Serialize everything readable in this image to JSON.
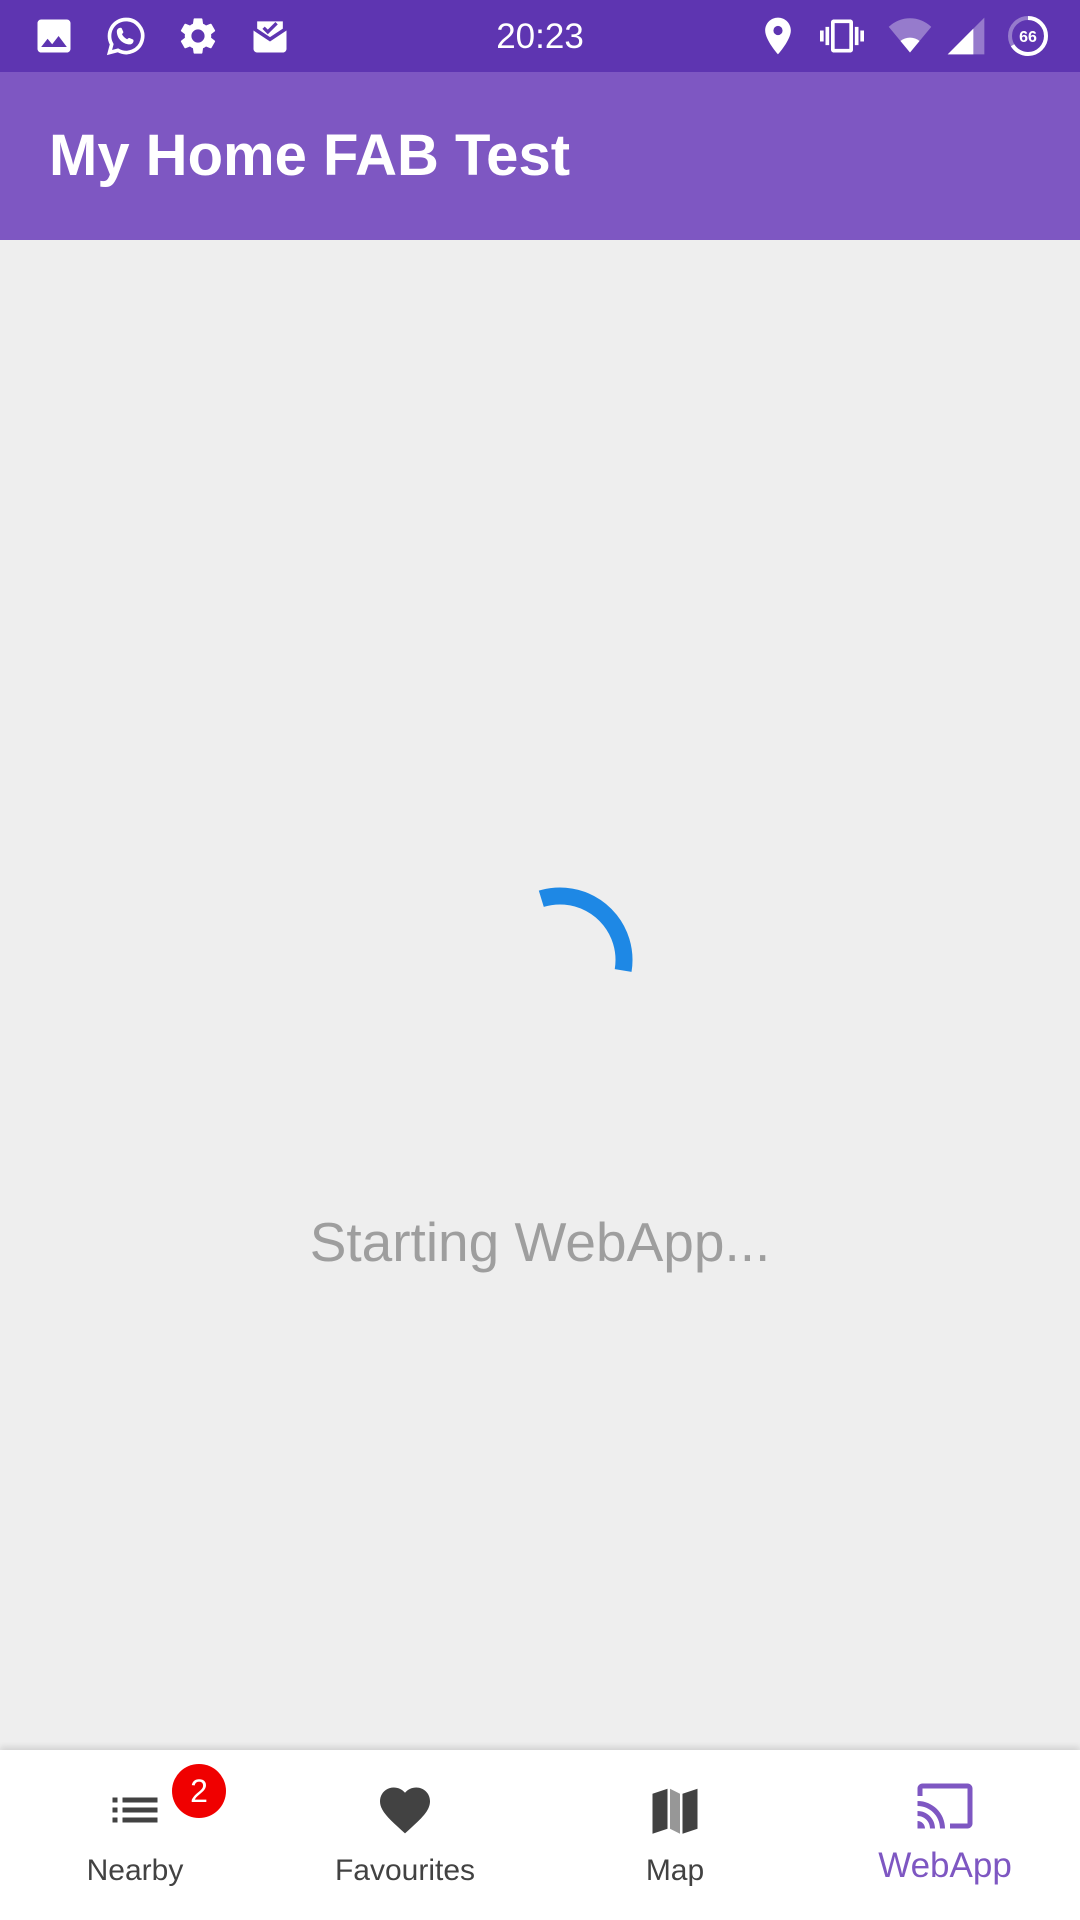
{
  "status_bar": {
    "time": "20:23",
    "battery_level": "66",
    "left_icons": [
      "gallery-icon",
      "whatsapp-icon",
      "settings-icon",
      "mail-check-icon"
    ],
    "right_icons": [
      "location-icon",
      "vibrate-icon",
      "wifi-icon",
      "cellular-signal-icon",
      "battery-saver-icon"
    ]
  },
  "app_bar": {
    "title": "My Home FAB Test"
  },
  "content": {
    "loading_text": "Starting WebApp...",
    "spinner_color": "#1e88e5"
  },
  "bottom_nav": {
    "items": [
      {
        "label": "Nearby",
        "icon": "list-icon",
        "badge": "2",
        "active": false
      },
      {
        "label": "Favourites",
        "icon": "heart-icon",
        "active": false
      },
      {
        "label": "Map",
        "icon": "map-icon",
        "active": false
      },
      {
        "label": "WebApp",
        "icon": "cast-icon",
        "active": true
      }
    ]
  },
  "colors": {
    "status_bar": "#5e35b1",
    "app_bar": "#7e57c2",
    "accent": "#7e57c2",
    "background": "#eeeeee",
    "badge": "#f00000"
  }
}
